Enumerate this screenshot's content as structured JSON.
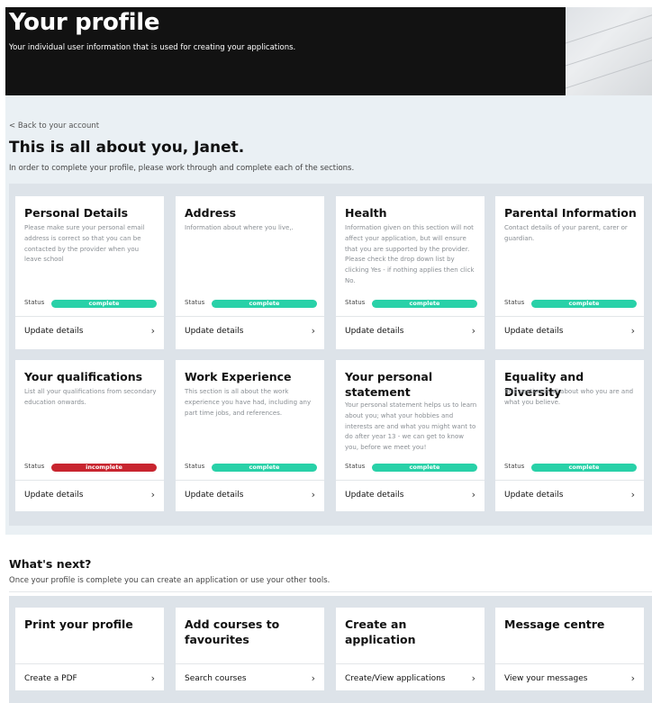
{
  "header": {
    "title": "Your profile",
    "subtitle": "Your individual user information that is used for creating your applications."
  },
  "back_link": "< Back to your account",
  "intro": {
    "title": "This is all about you, Janet.",
    "subtitle": "In order to complete your profile, please work through and complete each of the sections."
  },
  "status_label": "Status",
  "action_label": "Update details",
  "sections": [
    {
      "title": "Personal Details",
      "description": "Please make sure your personal email address is correct so that you can be contacted by the provider when you leave school",
      "status": "complete"
    },
    {
      "title": "Address",
      "description": "Information about where you live,.",
      "status": "complete"
    },
    {
      "title": "Health",
      "description": "Information given on this section will not affect your application, but will ensure that you are supported by the provider. Please check the drop down list by clicking Yes - if nothing applies then click No.",
      "status": "complete"
    },
    {
      "title": "Parental Information",
      "description": "Contact details of your parent, carer or guardian.",
      "status": "complete"
    },
    {
      "title": "Your qualifications",
      "description": "List all your qualifications from secondary education onwards.",
      "status": "incomplete"
    },
    {
      "title": "Work Experience",
      "description": "This section is all about the work experience you have had, including any part time jobs, and references.",
      "status": "complete"
    },
    {
      "title": "Your personal statement",
      "description": "Your personal statement helps us to learn about you; what your hobbies and interests are and what you might want to do after year 13 - we can get to know you, before we meet you!",
      "status": "complete"
    },
    {
      "title": "Equality and Diversity",
      "description": "This section is all about who you are and what you believe.",
      "status": "complete"
    }
  ],
  "colors": {
    "complete": "#28d1a8",
    "incomplete": "#c8252f",
    "header_bg": "#121212"
  },
  "whats_next": {
    "title": "What's next?",
    "subtitle": "Once your profile is complete you can create an application or use your other tools.",
    "tools": [
      {
        "title": "Print your profile",
        "action": "Create a PDF"
      },
      {
        "title": "Add courses to favourites",
        "action": "Search courses"
      },
      {
        "title": "Create an application",
        "action": "Create/View applications"
      },
      {
        "title": "Message centre",
        "action": "View your messages"
      }
    ]
  }
}
